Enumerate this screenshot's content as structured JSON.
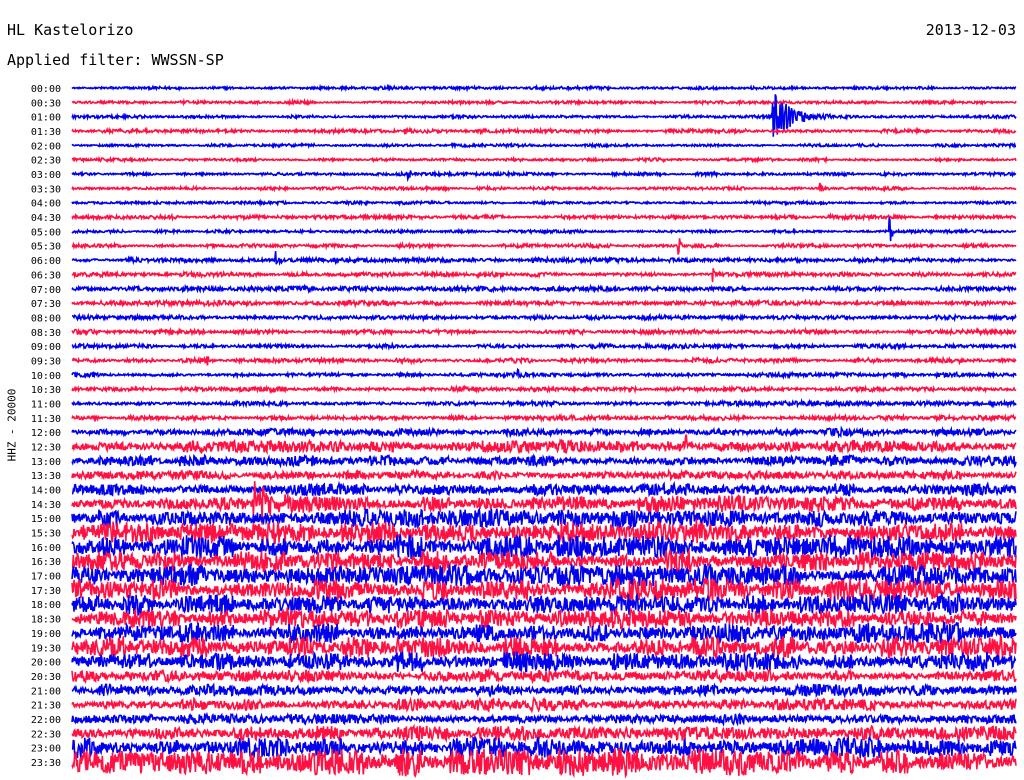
{
  "header": {
    "station": "HL Kastelorizo",
    "date": "2013-12-03",
    "filter": "Applied filter: WWSSN-SP",
    "channel": "HHZ - 20000"
  },
  "colors": {
    "odd_trace": "#0000ee",
    "even_trace": "#ff1144",
    "background": "#ffffff"
  },
  "chart_data": {
    "type": "line",
    "title": "HL Kastelorizo",
    "subtitle": "Applied filter: WWSSN-SP",
    "ylabel": "HHZ - 20000",
    "date": "2013-12-03",
    "trace_interval_minutes": 30,
    "grid": false,
    "row_labels": [
      "00:00",
      "00:30",
      "01:00",
      "01:30",
      "02:00",
      "02:30",
      "03:00",
      "03:30",
      "04:00",
      "04:30",
      "05:00",
      "05:30",
      "06:00",
      "06:30",
      "07:00",
      "07:30",
      "08:00",
      "08:30",
      "09:00",
      "09:30",
      "10:00",
      "10:30",
      "11:00",
      "11:30",
      "12:00",
      "12:30",
      "13:00",
      "13:30",
      "14:00",
      "14:30",
      "15:00",
      "15:30",
      "16:00",
      "16:30",
      "17:00",
      "17:30",
      "18:00",
      "18:30",
      "19:00",
      "19:30",
      "20:00",
      "20:30",
      "21:00",
      "21:30",
      "22:00",
      "22:30",
      "23:00",
      "23:30"
    ],
    "noise_level": [
      1,
      1,
      1,
      1.2,
      1,
      1,
      1.1,
      1.1,
      1,
      1.2,
      1,
      1.2,
      1.5,
      1.5,
      1.6,
      1.6,
      1.5,
      1.5,
      1.4,
      1.5,
      1.5,
      1.6,
      1.5,
      1.5,
      2.5,
      4,
      3.5,
      3,
      4,
      5.5,
      6,
      7,
      8,
      7,
      7.5,
      7.5,
      7,
      6.5,
      7,
      7,
      6.5,
      4,
      4,
      4,
      3.5,
      5,
      7,
      9
    ],
    "events": [
      {
        "row": 2,
        "x_minutes": 22.3,
        "amplitude": 26,
        "duration_minutes": 1.8
      },
      {
        "row": 3,
        "x_minutes": 10.6,
        "amplitude": 3,
        "duration_minutes": 1.0
      },
      {
        "row": 6,
        "x_minutes": 10.7,
        "amplitude": 5,
        "duration_minutes": 0.3
      },
      {
        "row": 7,
        "x_minutes": 23.8,
        "amplitude": 6,
        "duration_minutes": 0.3
      },
      {
        "row": 10,
        "x_minutes": 26.0,
        "amplitude": 16,
        "duration_minutes": 0.2
      },
      {
        "row": 11,
        "x_minutes": 19.3,
        "amplitude": 10,
        "duration_minutes": 0.2
      },
      {
        "row": 12,
        "x_minutes": 6.5,
        "amplitude": 8,
        "duration_minutes": 0.3
      },
      {
        "row": 13,
        "x_minutes": 20.4,
        "amplitude": 9,
        "duration_minutes": 0.2
      },
      {
        "row": 19,
        "x_minutes": 4.3,
        "amplitude": 7,
        "duration_minutes": 0.2
      },
      {
        "row": 20,
        "x_minutes": 14.2,
        "amplitude": 5,
        "duration_minutes": 0.2
      },
      {
        "row": 25,
        "x_minutes": 19.5,
        "amplitude": 10,
        "duration_minutes": 0.2
      },
      {
        "row": 26,
        "x_minutes": 26.0,
        "amplitude": 5,
        "duration_minutes": 0.2
      },
      {
        "row": 29,
        "x_minutes": 5.8,
        "amplitude": 26,
        "duration_minutes": 1.8
      },
      {
        "row": 31,
        "x_minutes": 19.8,
        "amplitude": 10,
        "duration_minutes": 0.3
      }
    ]
  }
}
